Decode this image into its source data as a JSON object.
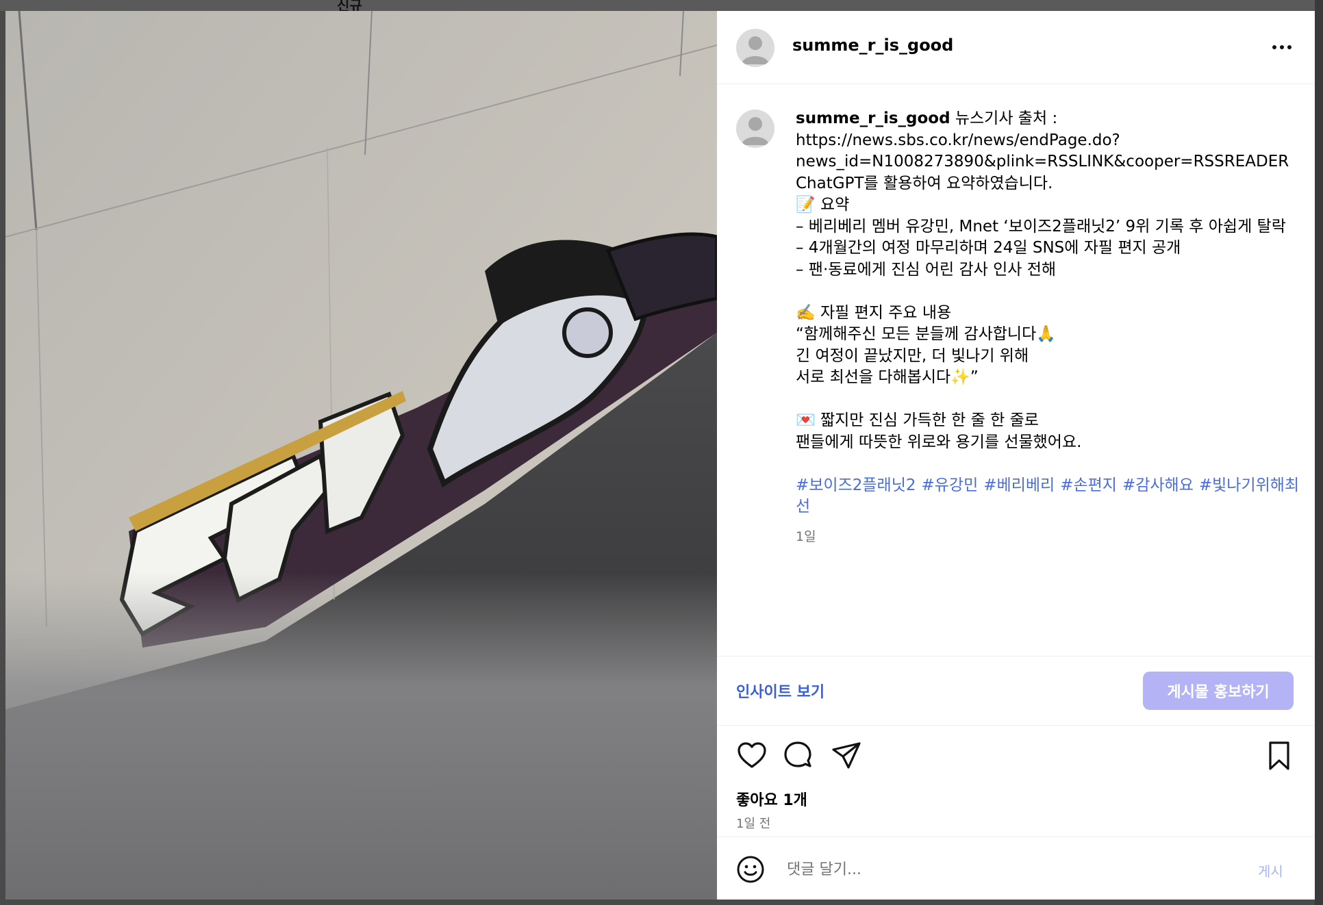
{
  "backdrop": {
    "label": "신규"
  },
  "post": {
    "username": "summe_r_is_good",
    "more_icon": "more-horizontal-icon"
  },
  "caption": {
    "username": "summe_r_is_good",
    "lines": [
      "뉴스기사 출처 :",
      "https://news.sbs.co.kr/news/endPage.do?",
      "news_id=N1008273890&plink=RSSLINK&cooper=RSSREADER",
      "ChatGPT를 활용하여 요약하였습니다.",
      "📝 요약",
      "– 베리베리 멤버 유강민, Mnet ‘보이즈2플래닛2’ 9위 기록 후 아쉽게 탈락",
      "– 4개월간의 여정 마무리하며 24일 SNS에 자필 편지 공개",
      "– 팬·동료에게 진심 어린 감사 인사 전해",
      "",
      "✍️ 자필 편지 주요 내용",
      "“함께해주신 모든 분들께 감사합니다🙏",
      "긴 여정이 끝났지만, 더 빛나기 위해",
      "서로 최선을 다해봅시다✨”",
      "",
      "💌 짧지만 진심 가득한 한 줄 한 줄로",
      "팬들에게 따뜻한 위로와 용기를 선물했어요."
    ],
    "hashtags": [
      "#보이즈2플래닛2",
      "#유강민",
      "#베리베리",
      "#손편지",
      "#감사해요",
      "#빛나기위해최선"
    ],
    "time": "1일"
  },
  "insights": {
    "link_label": "인사이트 보기",
    "promote_label": "게시물 홍보하기",
    "promote_color": "#b3b3f5"
  },
  "actions": {
    "icons": [
      "heart-icon",
      "comment-icon",
      "share-icon",
      "bookmark-icon"
    ],
    "likes": "좋아요 1개",
    "post_time": "1일 전"
  },
  "comment": {
    "placeholder": "댓글 달기...",
    "post_label": "게시",
    "post_color": "#a7b6f0"
  }
}
